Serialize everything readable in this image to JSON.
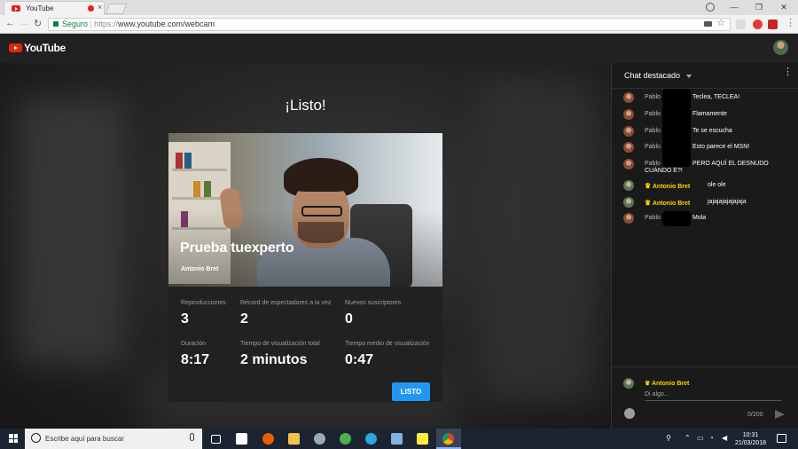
{
  "browser": {
    "tab_title": "YouTube",
    "tab_close": "×",
    "secure_label": "Seguro",
    "url_scheme": "https://",
    "url_rest": "www.youtube.com/webcam",
    "back": "←",
    "forward": "→",
    "reload": "↻",
    "star": "☆",
    "minimize": "—",
    "maximize": "❐",
    "close": "✕",
    "menu": "⋮"
  },
  "youtube": {
    "logo_text": "YouTube"
  },
  "main": {
    "heading": "¡Listo!",
    "stream": {
      "title": "Prueba tuexperto",
      "author": "Antonio Bret"
    },
    "stats": [
      {
        "label": "Reproducciones",
        "value": "3"
      },
      {
        "label": "Récord de espectadores a la vez",
        "value": "2"
      },
      {
        "label": "Nuevos suscriptores",
        "value": "0"
      },
      {
        "label": "Duración",
        "value": "8:17"
      },
      {
        "label": "Tiempo de visualización total",
        "value": "2 minutos"
      },
      {
        "label": "Tiempo medio de visualización",
        "value": "0:47"
      }
    ],
    "done_button": "LISTO"
  },
  "chat": {
    "header": "Chat destacado",
    "menu": "⋮",
    "messages": [
      {
        "author": "Pablo",
        "text": "Teclea, TECLEA!",
        "owner": false
      },
      {
        "author": "Pablo",
        "text": "Flamamente",
        "owner": false
      },
      {
        "author": "Pablo",
        "text": "Te se escucha",
        "owner": false
      },
      {
        "author": "Pablo",
        "text": "Esto parece el MSN!",
        "owner": false
      },
      {
        "author": "Pablo",
        "text": "PERO AQUÍ EL DESNUDO",
        "text2": "CUÁNDO É?!",
        "owner": false
      },
      {
        "author": "Antonio Bret",
        "text": "ole ole",
        "owner": true
      },
      {
        "author": "Antonio Bret",
        "text": "jajajajajajajaja",
        "owner": true
      },
      {
        "author": "Pablo",
        "text": "Mola",
        "owner": false
      }
    ],
    "input": {
      "author": "Antonio Bret",
      "placeholder": "Di algo...",
      "counter": "0/200"
    }
  },
  "taskbar": {
    "search_placeholder": "Escribe aquí para buscar",
    "time": "10:31",
    "date": "21/03/2018"
  },
  "colors": {
    "youtube_red": "#e62117",
    "button_blue": "#2196f3",
    "owner_gold": "#ffd600",
    "secure_green": "#0b8043"
  }
}
